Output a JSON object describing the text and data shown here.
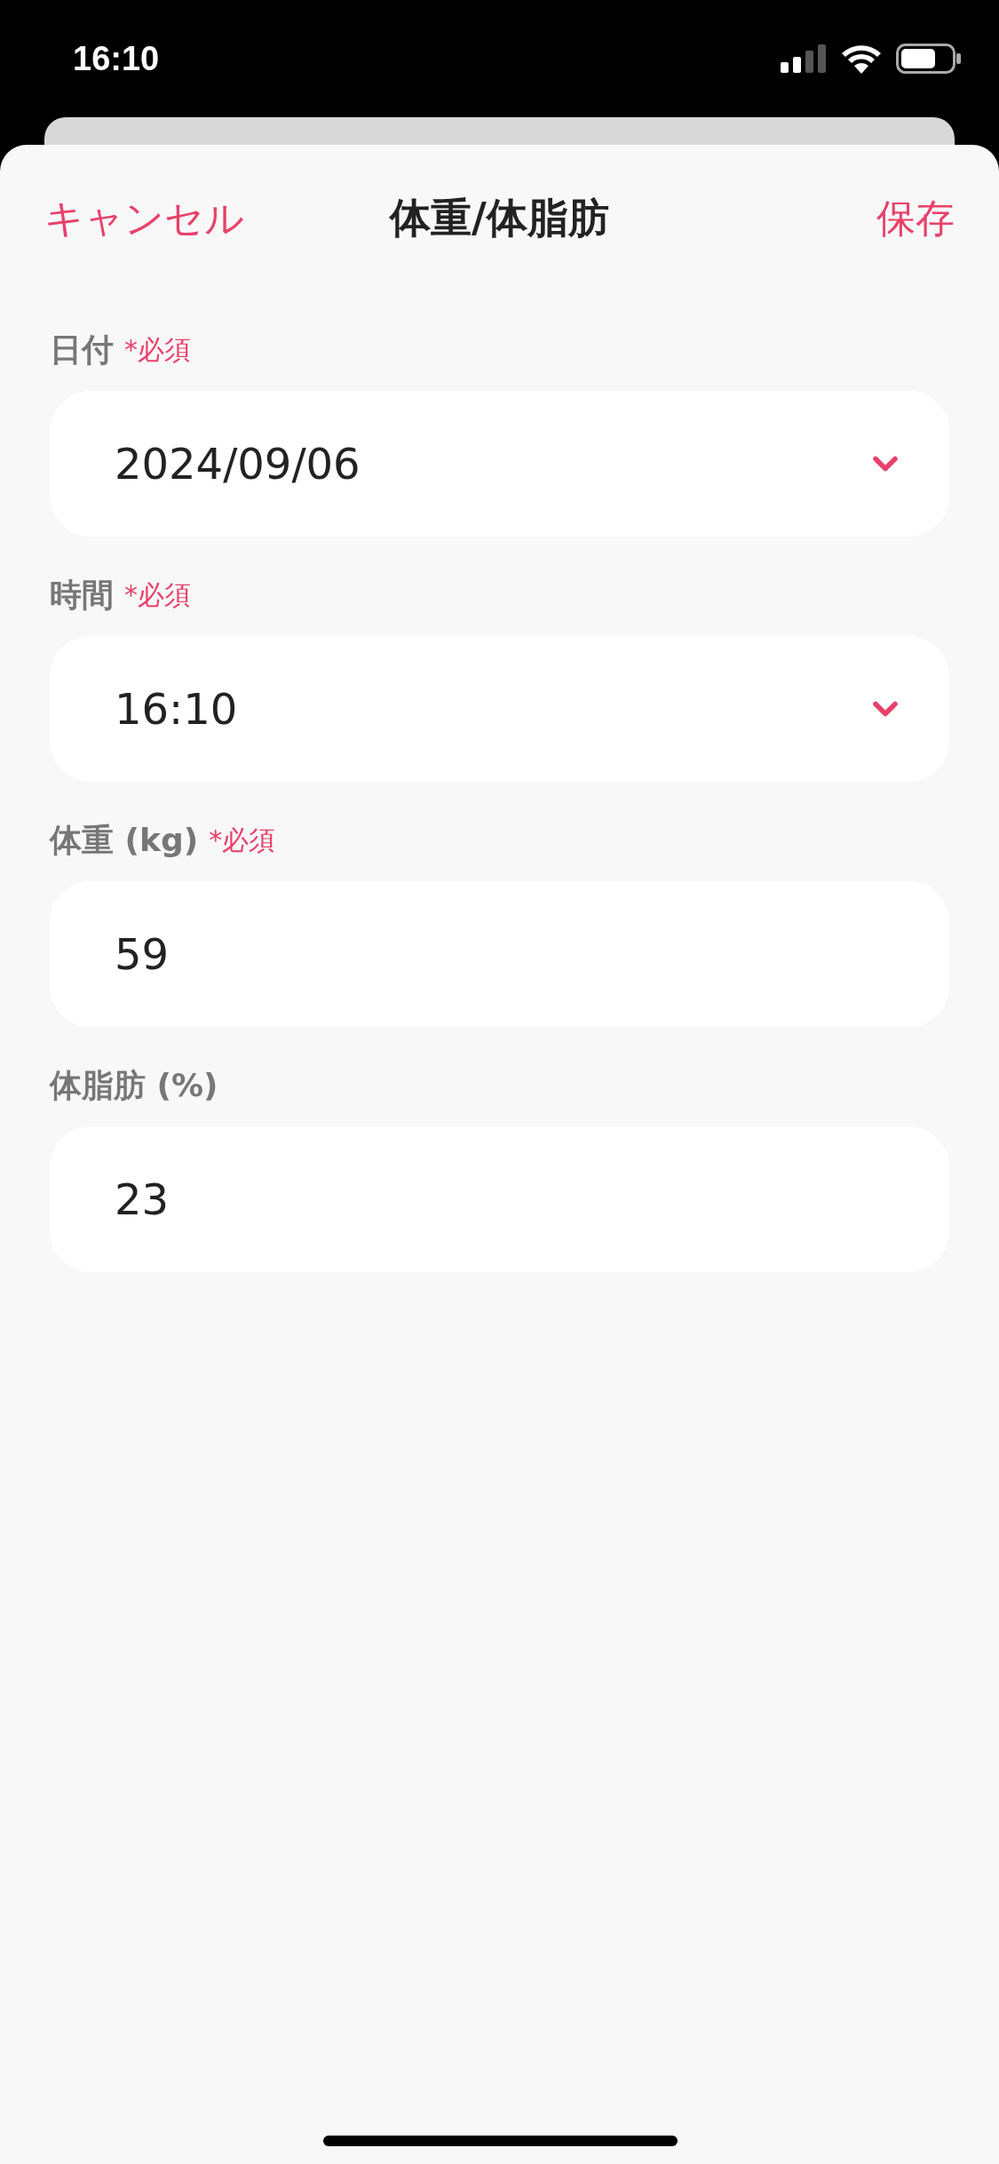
{
  "status_bar": {
    "time": "16:10"
  },
  "header": {
    "cancel": "キャンセル",
    "title": "体重/体脂肪",
    "save": "保存"
  },
  "fields": [
    {
      "kind": "picker",
      "label": "日付",
      "required_note": "*必須",
      "value": "2024/09/06"
    },
    {
      "kind": "picker",
      "label": "時間",
      "required_note": "*必須",
      "value": "16:10"
    },
    {
      "kind": "text",
      "label": "体重 (kg)",
      "required_note": "*必須",
      "value": "59"
    },
    {
      "kind": "text",
      "label": "体脂肪 (%)",
      "value": "23"
    }
  ]
}
